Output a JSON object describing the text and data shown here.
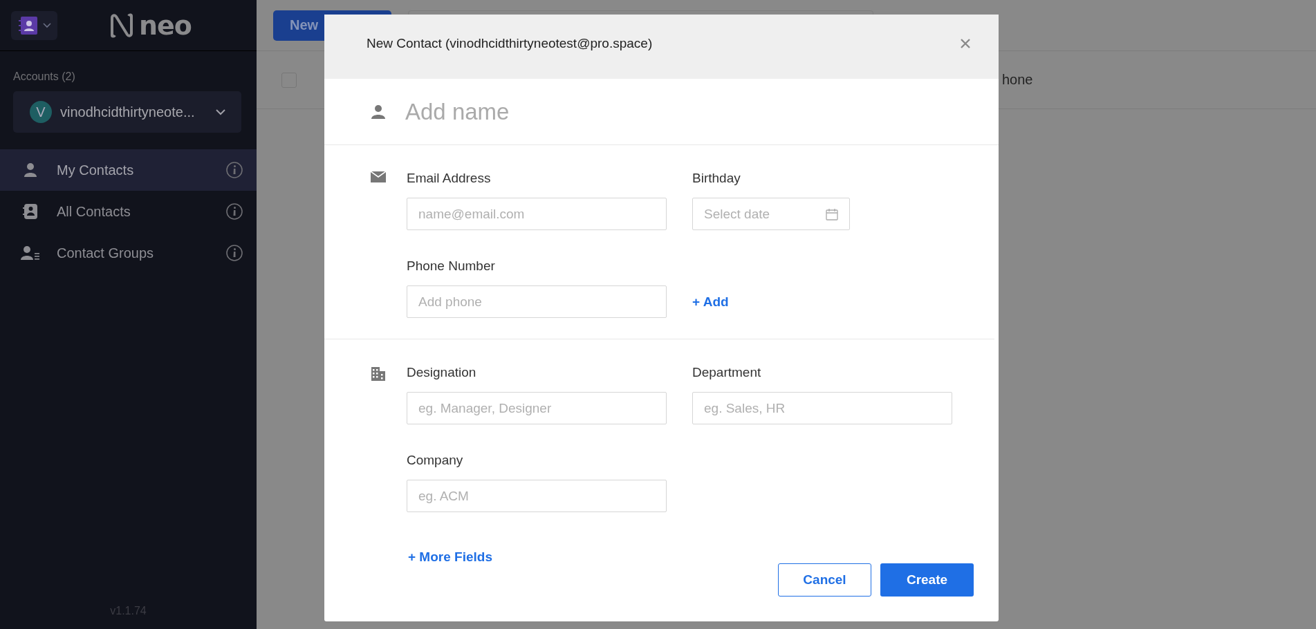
{
  "app": {
    "logo": "neo"
  },
  "sidebar": {
    "accounts_label": "Accounts (2)",
    "account": {
      "initial": "V",
      "name": "vinodhcidthirtyneote..."
    },
    "items": [
      {
        "label": "My Contacts",
        "selected": true
      },
      {
        "label": "All Contacts",
        "selected": false
      },
      {
        "label": "Contact Groups",
        "selected": false
      }
    ],
    "version": "v1.1.74"
  },
  "background": {
    "new_button": "New",
    "select_all_checked": false,
    "column_header": "hone"
  },
  "dialog": {
    "title": "New Contact (vinodhcidthirtyneotest@pro.space)",
    "name_placeholder": "Add name",
    "sections": [
      {
        "rows": [
          [
            {
              "kind": "text",
              "label": "Email Address",
              "placeholder": "name@email.com"
            },
            {
              "kind": "date",
              "label": "Birthday",
              "placeholder": "Select date"
            }
          ],
          [
            {
              "kind": "text",
              "label": "Phone Number",
              "placeholder": "Add phone"
            },
            {
              "kind": "link",
              "text": "+ Add"
            }
          ]
        ]
      },
      {
        "rows": [
          [
            {
              "kind": "text",
              "label": "Designation",
              "placeholder": "eg. Manager, Designer"
            },
            {
              "kind": "text",
              "label": "Department",
              "placeholder": "eg. Sales, HR"
            }
          ],
          [
            {
              "kind": "text",
              "label": "Company",
              "placeholder": "eg. ACM"
            }
          ]
        ]
      }
    ],
    "more_fields": "+ More Fields",
    "cancel": "Cancel",
    "create": "Create"
  }
}
